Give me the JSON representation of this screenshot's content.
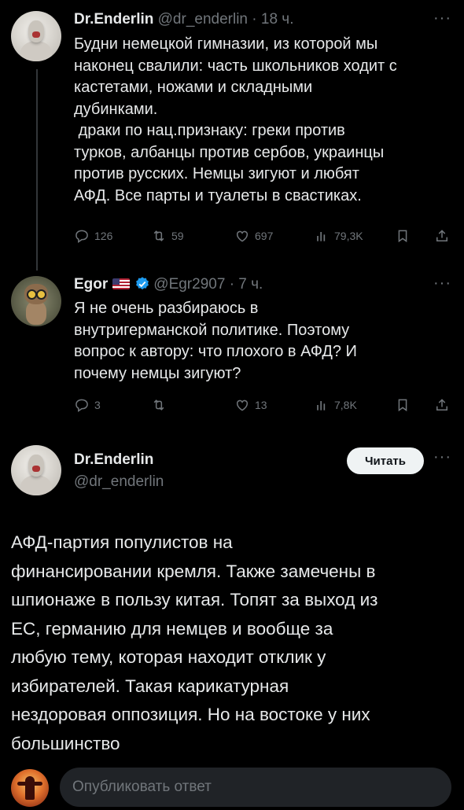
{
  "tweets": [
    {
      "name": "Dr.Enderlin",
      "handle": "@dr_enderlin",
      "time": "· 18 ч.",
      "text": "Будни немецкой гимназии, из которой мы\nнаконец свалили: часть школьников ходит с\nкастетами, ножами и складными\nдубинками.\n драки по нац.признаку: греки против\nтурков, албанцы против сербов, украинцы\nпротив русских. Немцы зигуют и любят\nАФД. Все парты и туалеты в свастиках.",
      "replies": "126",
      "retweets": "59",
      "likes": "697",
      "views": "79,3K"
    },
    {
      "name": "Egor",
      "handle": "@Egr2907",
      "time": "· 7 ч.",
      "text": "Я не очень разбираюсь в\nвнутригерманской политике. Поэтому\nвопрос к автору: что плохого в АФД? И\nпочему немцы зигуют?",
      "replies": "3",
      "retweets": "",
      "likes": "13",
      "views": "7,8K"
    }
  ],
  "main_tweet": {
    "name": "Dr.Enderlin",
    "handle": "@dr_enderlin",
    "follow_label": "Читать",
    "text": "АФД-партия популистов на\nфинансировании кремля. Также замечены в\nшпионаже в пользу китая. Топят за выход из\nЕС, германию для немцев и вообще за\nлюбую тему, которая находит отклик у\nизбирателей. Такая карикатурная\nнездоровая оппозиция. Но на востоке у них\nбольшинство"
  },
  "reply_bar": {
    "placeholder": "Опубликовать ответ"
  },
  "icons": {
    "more": "···",
    "verified_color": "#1d9bf0"
  }
}
